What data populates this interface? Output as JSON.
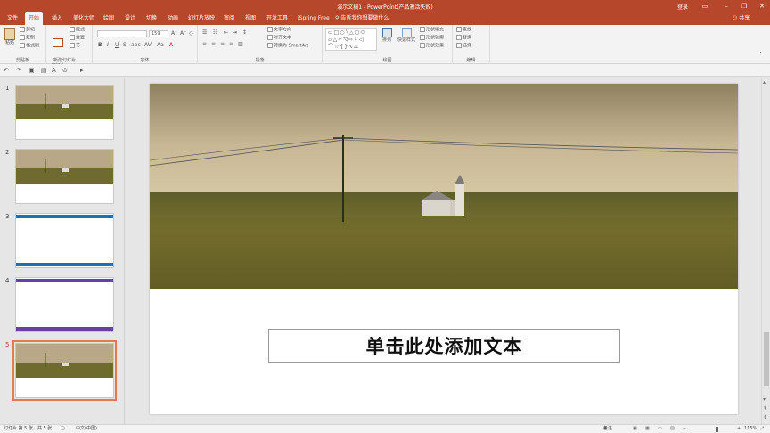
{
  "window": {
    "title": "演示文稿1  -  PowerPoint(产品激活失败)",
    "login": "登录"
  },
  "tabs": [
    "文件",
    "开始",
    "插入",
    "美化大师",
    "绘图",
    "设计",
    "切换",
    "动画",
    "幻灯片放映",
    "审阅",
    "视图",
    "开发工具",
    "iSpring Free"
  ],
  "active_tab": "开始",
  "tellme": "告诉我你想要做什么",
  "share": "共享",
  "ribbon": {
    "clipboard": {
      "label": "剪贴板",
      "paste": "粘贴",
      "cut": "剪切",
      "copy": "复制",
      "format_painter": "格式刷"
    },
    "slides": {
      "label": "幻灯片",
      "new_slide": "新建\n幻灯片",
      "layout": "版式",
      "reset": "重置",
      "section": "节"
    },
    "font": {
      "label": "字体",
      "font_name": "",
      "font_size": "159"
    },
    "paragraph": {
      "label": "段落",
      "text_direction": "文字方向",
      "align_text": "对齐文本",
      "smartart": "转换为 SmartArt"
    },
    "drawing": {
      "label": "绘图",
      "arrange": "排列",
      "quick_styles": "快速样式",
      "shape_fill": "形状填充",
      "shape_outline": "形状轮廓",
      "shape_effects": "形状效果"
    },
    "editing": {
      "label": "编辑",
      "find": "查找",
      "replace": "替换",
      "select": "选择"
    }
  },
  "thumbnails": [
    {
      "num": "1",
      "type": "photo"
    },
    {
      "num": "2",
      "type": "photo"
    },
    {
      "num": "3",
      "type": "blue"
    },
    {
      "num": "4",
      "type": "purple"
    },
    {
      "num": "5",
      "type": "photo"
    }
  ],
  "selected_slide": "5",
  "slide": {
    "textbox": "单击此处添加文本"
  },
  "status": {
    "slide_info": "幻灯片 第 5 张，共 5 张",
    "language": "中文(中国)",
    "notes": "备注",
    "zoom": "115%"
  },
  "colors": {
    "accent": "#b7472a",
    "blue_bar": "#1f6fb4",
    "purple_bar": "#6b3fa0"
  }
}
